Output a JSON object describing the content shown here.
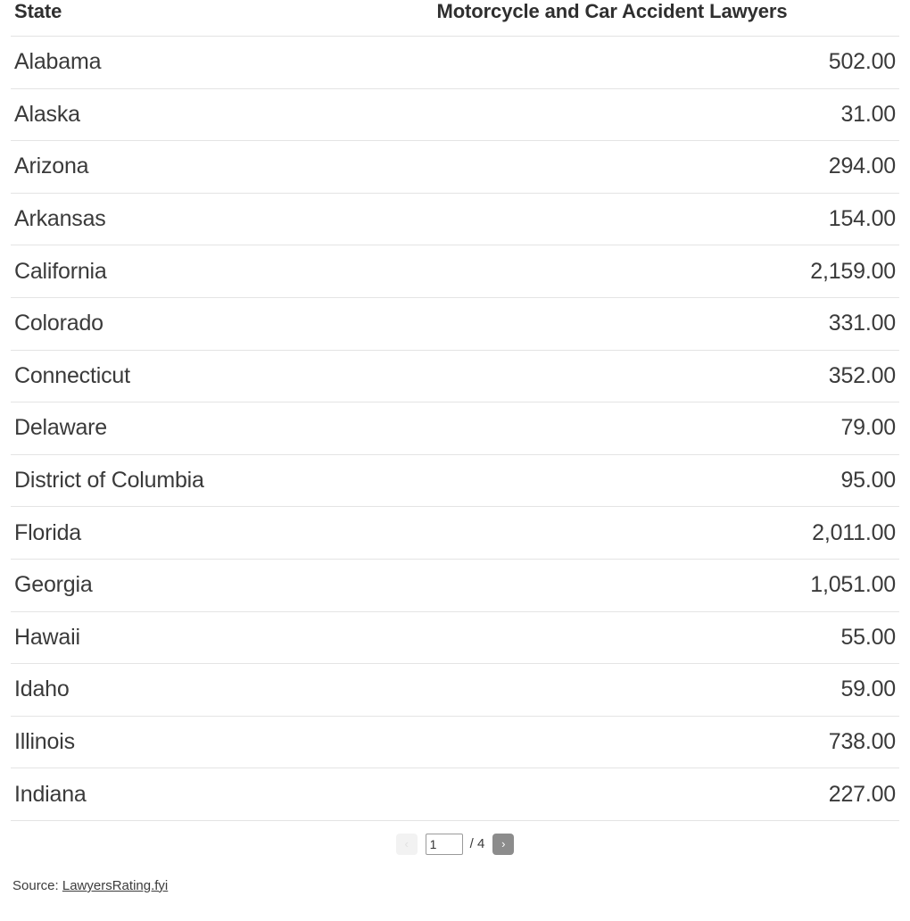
{
  "table": {
    "columns": [
      {
        "key": "state",
        "label": "State",
        "align": "left"
      },
      {
        "key": "value",
        "label": "Motorcycle and Car Accident Lawyers",
        "align": "center"
      }
    ],
    "rows": [
      {
        "state": "Alabama",
        "value": "502.00"
      },
      {
        "state": "Alaska",
        "value": "31.00"
      },
      {
        "state": "Arizona",
        "value": "294.00"
      },
      {
        "state": "Arkansas",
        "value": "154.00"
      },
      {
        "state": "California",
        "value": "2,159.00"
      },
      {
        "state": "Colorado",
        "value": "331.00"
      },
      {
        "state": "Connecticut",
        "value": "352.00"
      },
      {
        "state": "Delaware",
        "value": "79.00"
      },
      {
        "state": "District of Columbia",
        "value": "95.00"
      },
      {
        "state": "Florida",
        "value": "2,011.00"
      },
      {
        "state": "Georgia",
        "value": "1,051.00"
      },
      {
        "state": "Hawaii",
        "value": "55.00"
      },
      {
        "state": "Idaho",
        "value": "59.00"
      },
      {
        "state": "Illinois",
        "value": "738.00"
      },
      {
        "state": "Indiana",
        "value": "227.00"
      }
    ]
  },
  "pagination": {
    "prev_label": "‹",
    "next_label": "›",
    "current_page": "1",
    "total_pages_label": "/ 4",
    "total_pages": "4"
  },
  "footer": {
    "source_prefix": "Source: ",
    "source_link_text": "LawyersRating.fyi"
  },
  "colors": {
    "text": "#3a3a3a",
    "header_text": "#2f2f2f",
    "row_border": "#e4e4e4",
    "next_button_bg": "#8c8c8c",
    "prev_button_bg": "#f2f2f2",
    "background": "#ffffff"
  }
}
